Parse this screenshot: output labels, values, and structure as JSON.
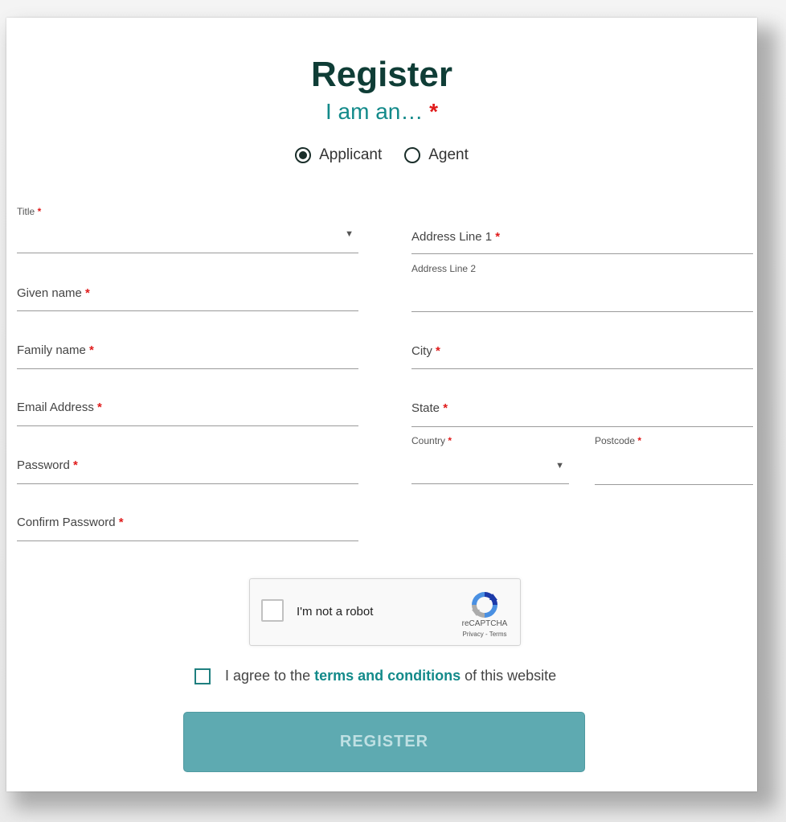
{
  "page": {
    "title": "Register",
    "subtitle": "I am an…",
    "required_mark": "*"
  },
  "role": {
    "options": [
      {
        "label": "Applicant",
        "selected": true
      },
      {
        "label": "Agent",
        "selected": false
      }
    ]
  },
  "left_fields": {
    "title": "Title",
    "given_name": "Given name",
    "family_name": "Family name",
    "email": "Email Address",
    "password": "Password",
    "confirm_password": "Confirm Password"
  },
  "right_fields": {
    "address1": "Address Line 1",
    "address2": "Address Line 2",
    "city": "City",
    "state": "State",
    "country": "Country",
    "postcode": "Postcode"
  },
  "recaptcha": {
    "label": "I'm not a robot",
    "brand": "reCAPTCHA",
    "privacy": "Privacy",
    "separator": " - ",
    "terms": "Terms"
  },
  "agreement": {
    "prefix": "I agree to the",
    "link": "terms and conditions",
    "suffix": "of this website"
  },
  "submit": {
    "label": "REGISTER"
  },
  "colors": {
    "accent": "#138a8a",
    "heading": "#0f3d36",
    "required": "#e01b1b",
    "button": "#5eaab1"
  }
}
